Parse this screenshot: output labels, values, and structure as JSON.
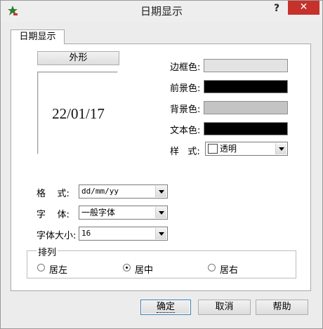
{
  "window": {
    "title": "日期显示",
    "help": "?",
    "close": "✕"
  },
  "tab": {
    "label": "日期显示"
  },
  "outline_button": "外形",
  "preview": {
    "text": "22/01/17"
  },
  "colors": [
    {
      "label": "边框色:",
      "color": "#e3e3e3"
    },
    {
      "label": "前景色:",
      "color": "#000000"
    },
    {
      "label": "背景色:",
      "color": "#c4c4c4"
    },
    {
      "label": "文本色:",
      "color": "#000000"
    }
  ],
  "style_row": {
    "label": "样   式:",
    "value": "透明"
  },
  "format": {
    "label": "格    式:",
    "value": "dd/mm/yy"
  },
  "font": {
    "label": "字    体:",
    "value": "一般字体"
  },
  "font_size": {
    "label": "字体大小:",
    "value": "16"
  },
  "arrange": {
    "legend": "排列",
    "options": [
      {
        "label": "居左",
        "selected": false
      },
      {
        "label": "居中",
        "selected": true
      },
      {
        "label": "居右",
        "selected": false
      }
    ]
  },
  "buttons": {
    "ok": "确定",
    "cancel": "取消",
    "help": "帮助"
  }
}
